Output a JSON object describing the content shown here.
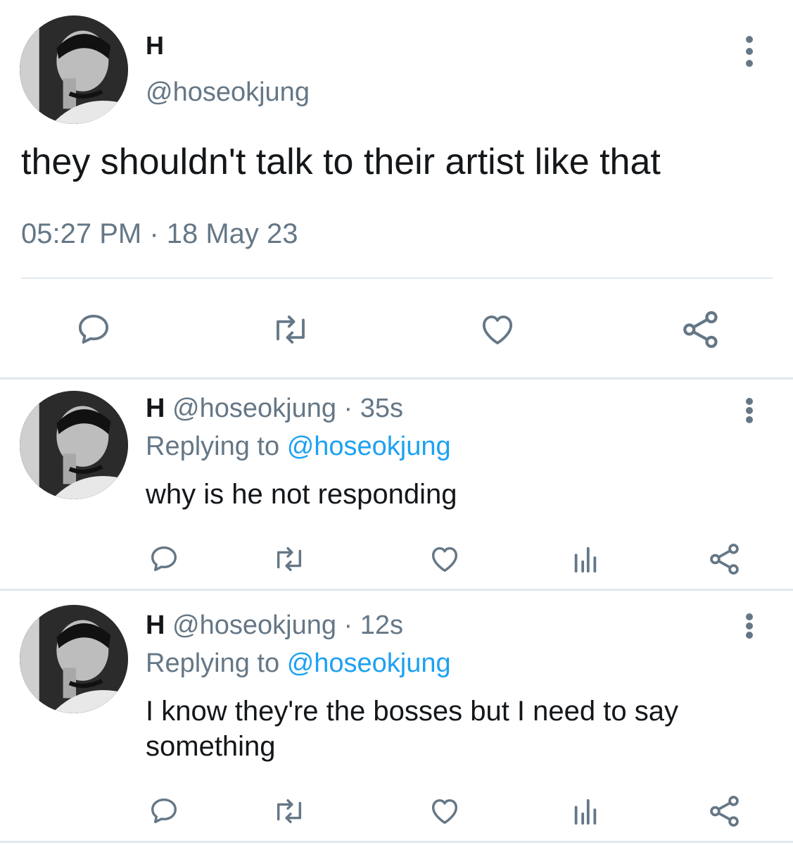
{
  "main_tweet": {
    "name": "H",
    "handle": "@hoseokjung",
    "text": "they shouldn't talk to their artist like that",
    "timestamp": "05:27 PM · 18 May 23",
    "icons": [
      "comment-icon",
      "retweet-icon",
      "like-icon",
      "share-icon"
    ]
  },
  "replies": [
    {
      "name": "H",
      "handle": "@hoseokjung",
      "age": "· 35s",
      "replying_label": "Replying to",
      "replying_to": "@hoseokjung",
      "text": "why is he not responding",
      "icons": [
        "comment-icon",
        "retweet-icon",
        "like-icon",
        "analytics-icon",
        "share-icon"
      ]
    },
    {
      "name": "H",
      "handle": "@hoseokjung",
      "age": "· 12s",
      "replying_label": "Replying to",
      "replying_to": "@hoseokjung",
      "text": "I know they're the bosses but I need to say something",
      "icons": [
        "comment-icon",
        "retweet-icon",
        "like-icon",
        "analytics-icon",
        "share-icon"
      ]
    }
  ],
  "colors": {
    "text": "#14171a",
    "secondary": "#657786",
    "link": "#1da1f2",
    "divider": "#e1e8ed"
  }
}
